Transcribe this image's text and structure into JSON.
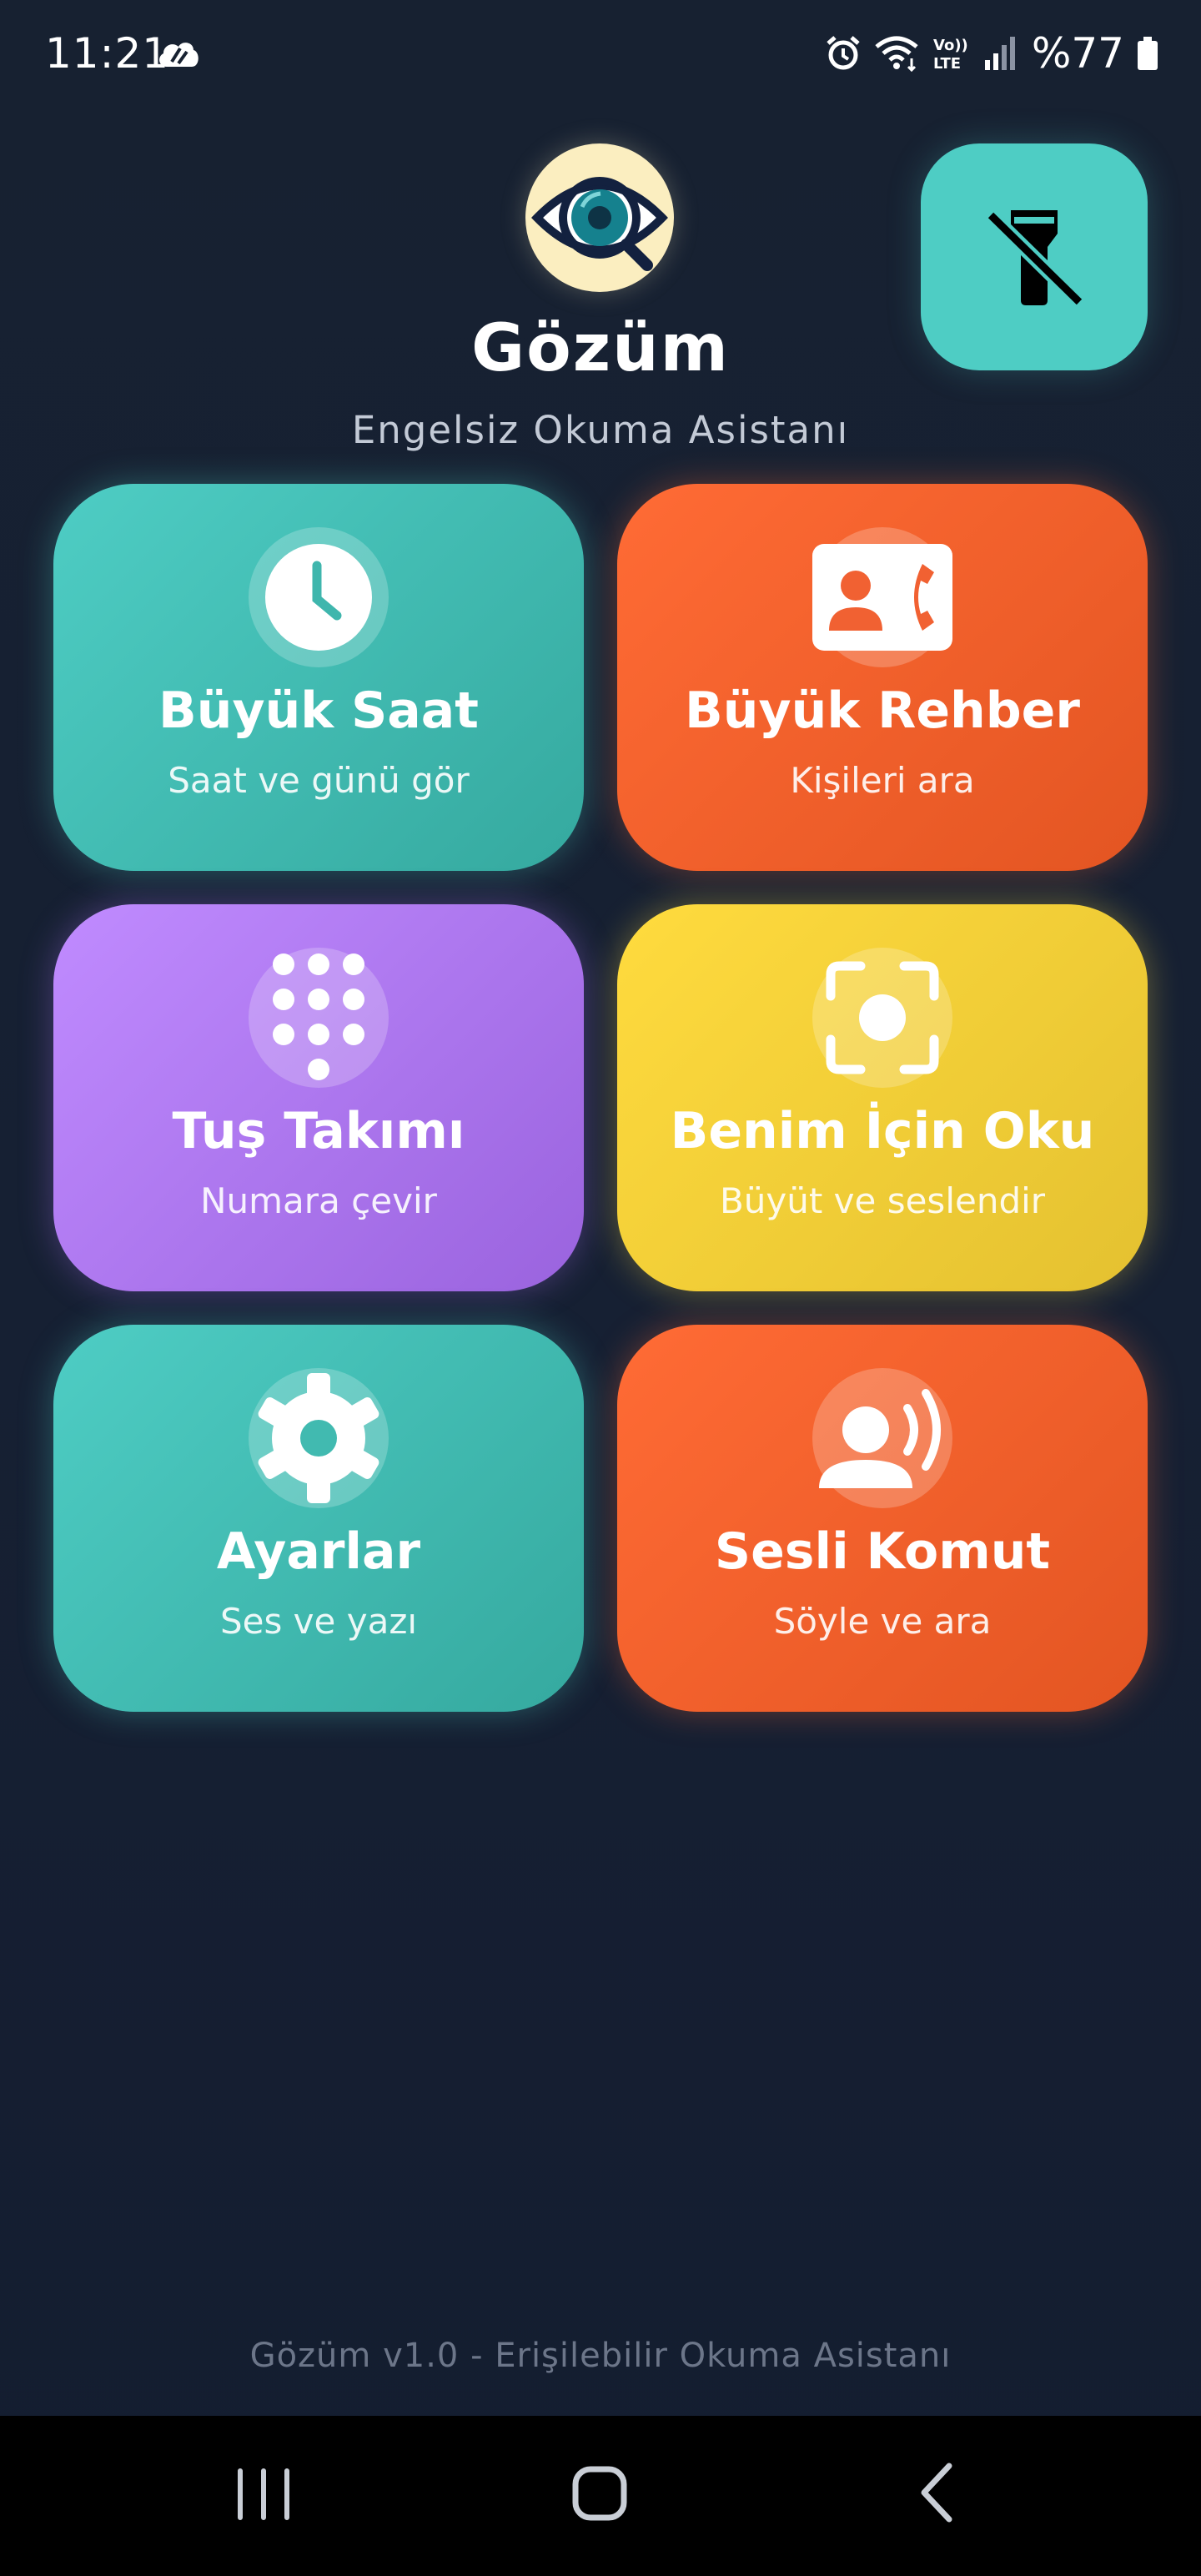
{
  "status_bar": {
    "time": "11:21",
    "battery": "%77",
    "network": "Vo)) LTE",
    "icons": [
      "cloud-icon",
      "alarm-icon",
      "wifi-icon",
      "volte-icon",
      "signal-icon",
      "battery-icon"
    ]
  },
  "header": {
    "title": "Gözüm",
    "subtitle": "Engelsiz Okuma Asistanı",
    "logo_icon": "eye-magnifier-icon",
    "flashlight_icon": "flashlight-off-icon"
  },
  "tiles": [
    {
      "title": "Büyük Saat",
      "subtitle": "Saat ve günü gör",
      "icon": "clock-icon",
      "color": "#4ecdc4"
    },
    {
      "title": "Büyük Rehber",
      "subtitle": "Kişileri ara",
      "icon": "contact-phone-icon",
      "color": "#ff6b35"
    },
    {
      "title": "Tuş Takımı",
      "subtitle": "Numara çevir",
      "icon": "dialpad-icon",
      "color": "#b37ff5"
    },
    {
      "title": "Benim İçin Oku",
      "subtitle": "Büyüt ve seslendir",
      "icon": "camera-scan-icon",
      "color": "#f5d136"
    },
    {
      "title": "Ayarlar",
      "subtitle": "Ses ve yazı",
      "icon": "gear-icon",
      "color": "#4ecdc4"
    },
    {
      "title": "Sesli Komut",
      "subtitle": "Söyle ve ara",
      "icon": "voice-command-icon",
      "color": "#ff6b35"
    }
  ],
  "footer": {
    "text": "Gözüm v1.0 - Erişilebilir Okuma Asistanı"
  },
  "nav_bar": {
    "icons": [
      "recents-icon",
      "home-icon",
      "back-icon"
    ]
  },
  "colors": {
    "background": "#172131",
    "teal": "#4ecdc4",
    "orange": "#ff6b35",
    "purple": "#b37ff5",
    "yellow": "#f5d136",
    "logo_bg": "#fbeec0"
  }
}
